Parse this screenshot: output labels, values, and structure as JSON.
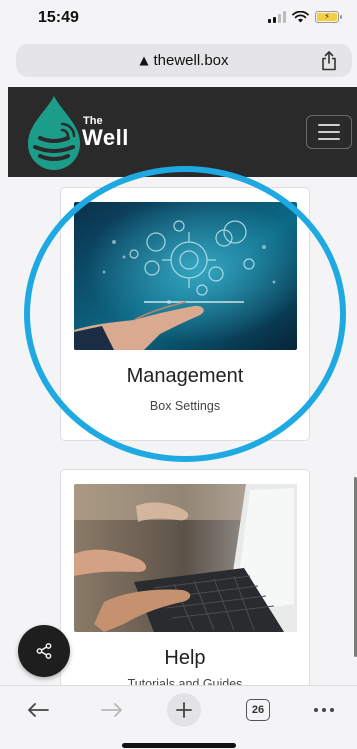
{
  "status_bar": {
    "time": "15:49"
  },
  "address_bar": {
    "url": "thewell.box"
  },
  "header": {
    "brand_small": "The",
    "brand_large": "Well"
  },
  "cards": [
    {
      "title": "Management",
      "subtitle": "Box Settings"
    },
    {
      "title": "Help",
      "subtitle": "Tutorials and Guides"
    }
  ],
  "toolbar": {
    "tab_count": "26"
  },
  "colors": {
    "header_bg": "#2a2a2b",
    "logo_teal": "#1b9d8a",
    "highlight_ring": "#1fa9e3",
    "fab_bg": "#1e1e1e"
  }
}
